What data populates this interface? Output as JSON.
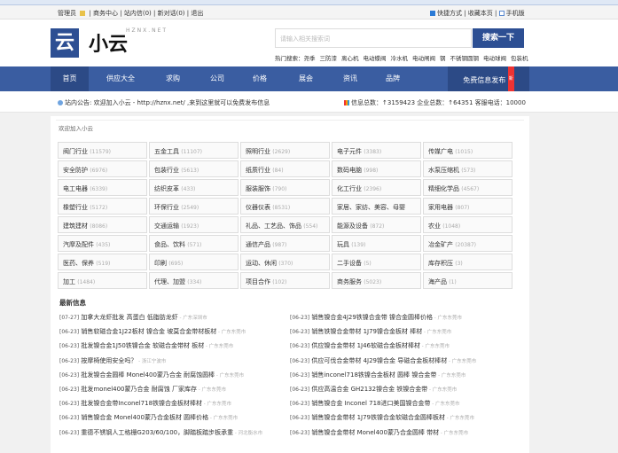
{
  "topbar": {
    "user": "管理员",
    "links": [
      "商务中心",
      "站内信(0)",
      "新对话(0)",
      "退出"
    ],
    "right": [
      "快捷方式",
      "收藏本页",
      "手机版"
    ]
  },
  "logo": {
    "mark": "云",
    "name": "小云",
    "sub": "HZNX.NET"
  },
  "search": {
    "placeholder": "请输入相关搜索词",
    "button": "搜索一下",
    "hot_label": "热门搜索：",
    "hot": [
      "尧季",
      "三防漆",
      "离心机",
      "电动蝶阀",
      "冷水机",
      "电动闸阀",
      "钢",
      "不锈钢圆钢",
      "电动球阀",
      "包装机"
    ]
  },
  "nav": {
    "items": [
      "首页",
      "供应大全",
      "求购",
      "公司",
      "价格",
      "展会",
      "资讯",
      "品牌"
    ],
    "publish": "免费信息发布",
    "badge": "新"
  },
  "notice": {
    "text": "站内公告: 欢迎加入小云 - http://hznx.net/ ,来到这里就可以免费发布信息",
    "stats": "信息总数：↑3159423  企业总数：↑64351  客服电话：10000"
  },
  "welcome": "欢迎加入小云",
  "categories": [
    {
      "name": "阀门行业",
      "count": "(11579)"
    },
    {
      "name": "五金工具",
      "count": "(11107)"
    },
    {
      "name": "照明行业",
      "count": "(2629)"
    },
    {
      "name": "电子元件",
      "count": "(3383)"
    },
    {
      "name": "传媒广电",
      "count": "(1015)"
    },
    {
      "name": "安全防护",
      "count": "(6976)"
    },
    {
      "name": "包装行业",
      "count": "(5613)"
    },
    {
      "name": "纸质行业",
      "count": "(84)"
    },
    {
      "name": "数码电脑",
      "count": "(998)"
    },
    {
      "name": "水泵压缩机",
      "count": "(573)"
    },
    {
      "name": "电工电器",
      "count": "(6339)"
    },
    {
      "name": "纺织皮革",
      "count": "(433)"
    },
    {
      "name": "服装服饰",
      "count": "(790)"
    },
    {
      "name": "化工行业",
      "count": "(2396)"
    },
    {
      "name": "精细化学品",
      "count": "(4567)"
    },
    {
      "name": "橡塑行业",
      "count": "(5172)"
    },
    {
      "name": "环保行业",
      "count": "(2549)"
    },
    {
      "name": "仪器仪表",
      "count": "(8531)"
    },
    {
      "name": "家居、家纺、美容、母婴",
      "count": ""
    },
    {
      "name": "家用电器",
      "count": "(807)"
    },
    {
      "name": "建筑建材",
      "count": "(8086)"
    },
    {
      "name": "交通运输",
      "count": "(1923)"
    },
    {
      "name": "礼品、工艺品、饰品",
      "count": "(554)"
    },
    {
      "name": "能源及设备",
      "count": "(872)"
    },
    {
      "name": "农业",
      "count": "(1048)"
    },
    {
      "name": "汽摩及配件",
      "count": "(435)"
    },
    {
      "name": "食品、饮料",
      "count": "(571)"
    },
    {
      "name": "通信产品",
      "count": "(987)"
    },
    {
      "name": "玩具",
      "count": "(139)"
    },
    {
      "name": "冶金矿产",
      "count": "(20387)"
    },
    {
      "name": "医药、保养",
      "count": "(519)"
    },
    {
      "name": "印刷",
      "count": "(695)"
    },
    {
      "name": "运动、休闲",
      "count": "(370)"
    },
    {
      "name": "二手设备",
      "count": "(5)"
    },
    {
      "name": "库存积压",
      "count": "(3)"
    },
    {
      "name": "加工",
      "count": "(1484)"
    },
    {
      "name": "代理、加盟",
      "count": "(334)"
    },
    {
      "name": "项目合作",
      "count": "(102)"
    },
    {
      "name": "商务服务",
      "count": "(5023)"
    },
    {
      "name": "海产品",
      "count": "(1)"
    }
  ],
  "news_title": "最新信息",
  "news_left": [
    {
      "d": "[07-27]",
      "t": "加拿大龙虾批发 高蛋白 低脂肪龙虾",
      "loc": " - 广东深圳市"
    },
    {
      "d": "[06-23]",
      "t": "销售软磁合金1J22板材 镍合金 坡莫合金带材板材",
      "loc": " - 广东东莞市"
    },
    {
      "d": "[06-23]",
      "t": "批发镍合金1J50铁镍合金 软磁合金带材 板材",
      "loc": " - 广东东莞市"
    },
    {
      "d": "[06-23]",
      "t": "按摩椅使用安全吗？",
      "loc": " - 浙江宁波市"
    },
    {
      "d": "[06-23]",
      "t": "批发镍合金圆棒 Monel400蒙乃合金 耐腐蚀圆棒",
      "loc": " - 广东东莞市"
    },
    {
      "d": "[06-23]",
      "t": "批发monel400蒙乃合金 耐腐蚀 厂家库存",
      "loc": " - 广东东莞市"
    },
    {
      "d": "[06-23]",
      "t": "批发镍合金带Inconel718铁镍合金板材棒材",
      "loc": " - 广东东莞市"
    },
    {
      "d": "[06-23]",
      "t": "销售镍合金 Monel400蒙乃合金板材 圆棒价格",
      "loc": " - 广东东莞市"
    },
    {
      "d": "[06-23]",
      "t": "重德不锈钢人工格栅G203/60/100，脚踏板踏步板承重",
      "loc": " - 河北衡水市"
    }
  ],
  "news_right": [
    {
      "d": "[06-23]",
      "t": "销售镍合金4J29铁镍合金带 镍合金圆棒价格",
      "loc": " - 广东东莞市"
    },
    {
      "d": "[06-23]",
      "t": "销售铁镍合金带材 1J79镍合金板材 棒材",
      "loc": " - 广东东莞市"
    },
    {
      "d": "[06-23]",
      "t": "供应镍合金带材 1J46软磁合金板材棒材",
      "loc": " - 广东东莞市"
    },
    {
      "d": "[06-23]",
      "t": "供应可伐合金带材 4J29镍合金 导磁合金板材棒材",
      "loc": " - 广东东莞市"
    },
    {
      "d": "[06-23]",
      "t": "销售inconel718铁镍合金板材 圆棒 镍合金带",
      "loc": " - 广东东莞市"
    },
    {
      "d": "[06-23]",
      "t": "供应高温合金 GH2132镍合金 铁镍合金带",
      "loc": " - 广东东莞市"
    },
    {
      "d": "[06-23]",
      "t": "销售镍合金 Inconel 718进口美国镍合金带",
      "loc": " - 广东东莞市"
    },
    {
      "d": "[06-23]",
      "t": "销售镍合金带材 1J79铁镍合金软磁合金圆棒板材",
      "loc": " - 广东东莞市"
    },
    {
      "d": "[06-23]",
      "t": "销售镍合金带材 Monel400蒙乃合金圆棒 带材",
      "loc": " - 广东东莞市"
    }
  ]
}
